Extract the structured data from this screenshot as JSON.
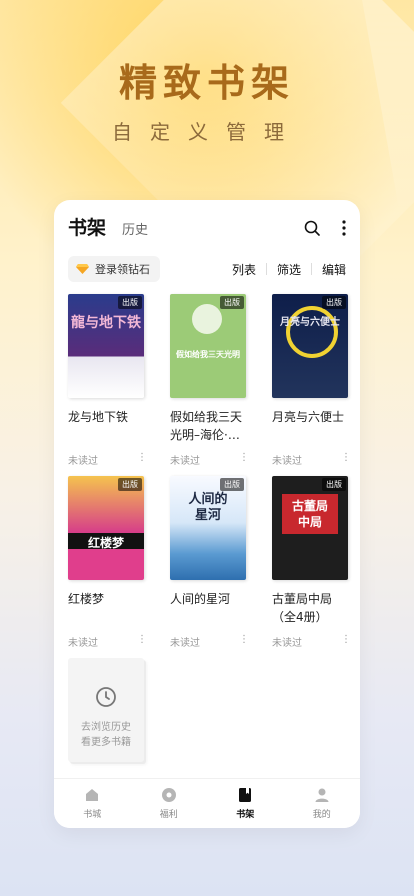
{
  "hero": {
    "title": "精致书架",
    "subtitle": "自定义管理"
  },
  "header": {
    "tabs": [
      {
        "label": "书架",
        "active": true
      },
      {
        "label": "历史",
        "active": false
      }
    ],
    "icons": [
      "search-icon",
      "more-vertical-icon"
    ]
  },
  "toolbar": {
    "diamond_label": "登录领钻石",
    "list_label": "列表",
    "filter_label": "筛选",
    "edit_label": "编辑"
  },
  "books": [
    {
      "title": "龙与地下铁",
      "status": "未读过",
      "badge": "出版",
      "cover_text": "龍与地下铁"
    },
    {
      "title": "假如给我三天光明–海伦·…",
      "status": "未读过",
      "badge": "出版",
      "cover_text": "假如给我三天光明"
    },
    {
      "title": "月亮与六便士",
      "status": "未读过",
      "badge": "出版",
      "cover_text": "月亮与六便士"
    },
    {
      "title": "红楼梦",
      "status": "未读过",
      "badge": "出版",
      "cover_text": "红楼梦"
    },
    {
      "title": "人间的星河",
      "status": "未读过",
      "badge": "出版",
      "cover_text": "人间的星河"
    },
    {
      "title": "古董局中局（全4册）",
      "status": "未读过",
      "badge": "出版",
      "cover_text": "古董局中局"
    }
  ],
  "history_card": {
    "line1": "去浏览历史",
    "line2": "看更多书籍"
  },
  "bottom_nav": [
    {
      "label": "书城",
      "icon": "home-icon",
      "active": false
    },
    {
      "label": "福利",
      "icon": "gift-icon",
      "active": false
    },
    {
      "label": "书架",
      "icon": "bookshelf-icon",
      "active": true
    },
    {
      "label": "我的",
      "icon": "profile-icon",
      "active": false
    }
  ],
  "colors": {
    "hero_title": "#A86A1B",
    "accent_diamond": "#F5A623"
  }
}
